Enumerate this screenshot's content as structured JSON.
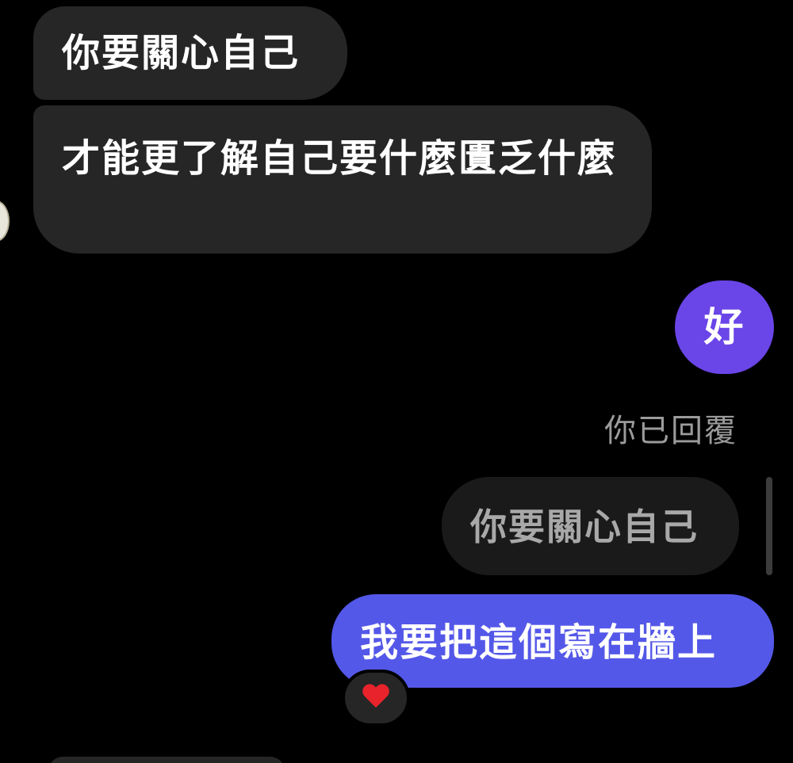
{
  "messages": {
    "incoming_1": "你要關心自己",
    "incoming_2": "才能更了解自己要什麼匱乏什麼",
    "outgoing_1": "好",
    "reply_label": "你已回覆",
    "quoted_reply": "你要關心自己",
    "outgoing_2": "我要把這個寫在牆上",
    "reaction": "heart-emoji"
  },
  "colors": {
    "background": "#000000",
    "incoming_bubble": "#262626",
    "outgoing_purple": "#6a45e8",
    "outgoing_blue": "#5458e8",
    "quoted_bubble": "#1a1a1a",
    "reaction_heart": "#e8232b"
  }
}
